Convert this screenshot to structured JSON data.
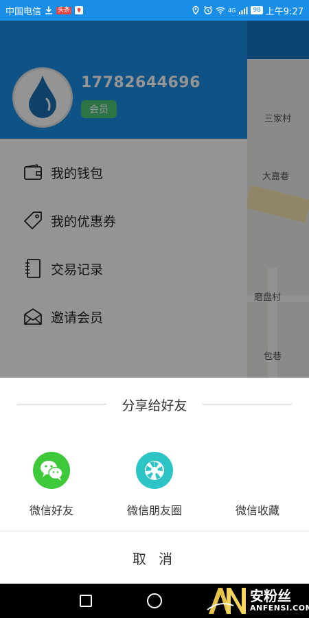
{
  "status_bar": {
    "carrier": "中国电信",
    "battery": "98",
    "time": "上午9:27",
    "signal_text": "4G"
  },
  "map": {
    "labels": [
      "三家村",
      "大嘉巷",
      "磨盘村",
      "包巷"
    ]
  },
  "drawer": {
    "phone": "17782644696",
    "member_tag": "会员",
    "menu": [
      {
        "label": "我的钱包",
        "icon": "wallet-icon"
      },
      {
        "label": "我的优惠券",
        "icon": "coupon-tag-icon"
      },
      {
        "label": "交易记录",
        "icon": "notebook-icon"
      },
      {
        "label": "邀请会员",
        "icon": "mail-invite-icon"
      }
    ]
  },
  "share_sheet": {
    "title": "分享给好友",
    "options": [
      {
        "label": "微信好友",
        "icon": "wechat-icon",
        "color": "#3ec93b"
      },
      {
        "label": "微信朋友圈",
        "icon": "moments-aperture-icon",
        "color": "#2cc4c4"
      },
      {
        "label": "微信收藏",
        "icon": "favorites-icon",
        "color": ""
      }
    ],
    "cancel": "取 消"
  },
  "watermark": {
    "cn": "安粉丝",
    "en": "ANFENSI.COM"
  },
  "colors": {
    "primary_blue": "#1a8ee6",
    "member_green": "#4fc97b"
  }
}
